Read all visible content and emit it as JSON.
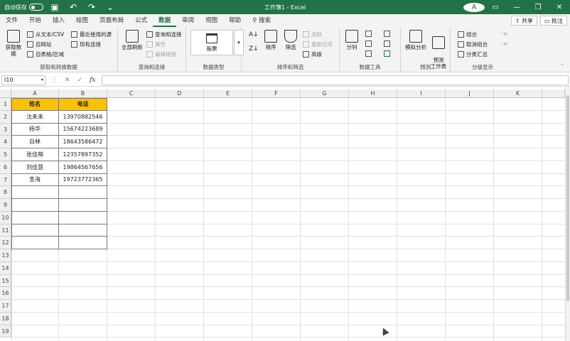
{
  "titlebar": {
    "autosave_label": "自动保存",
    "title": "工作簿1 - Excel",
    "avatar_letter": "A"
  },
  "menu": {
    "tabs": [
      "文件",
      "开始",
      "插入",
      "绘图",
      "页面布局",
      "公式",
      "数据",
      "审阅",
      "视图",
      "帮助",
      "搜索"
    ],
    "active": "数据",
    "share": "共享",
    "comments": "批注"
  },
  "ribbon": {
    "get_data": "获取数据",
    "from_text_csv": "从文本/CSV",
    "from_web": "自网站",
    "from_table": "自表格/区域",
    "recent_sources": "最近使用的源",
    "existing_conn": "现有连接",
    "group_get_transform": "获取和转换数据",
    "refresh_all": "全部刷新",
    "queries_conn": "查询和连接",
    "properties": "属性",
    "edit_links": "编辑链接",
    "group_queries": "查询和连接",
    "stocks": "股票",
    "group_data_types": "数据类型",
    "sort": "排序",
    "filter": "筛选",
    "clear": "清除",
    "reapply": "重新应用",
    "advanced": "高级",
    "group_sort_filter": "排序和筛选",
    "text_to_columns": "分列",
    "group_data_tools": "数据工具",
    "what_if": "模拟分析",
    "forecast_sheet": "预测\n工作表",
    "group_forecast": "预测",
    "group_btn": "组合",
    "ungroup": "取消组合",
    "subtotal": "分类汇总",
    "group_outline": "分级显示"
  },
  "formula_bar": {
    "name_box": "I10",
    "fx": "fx",
    "cancel": "✕",
    "enter": "✓",
    "value": ""
  },
  "columns": [
    "A",
    "B",
    "C",
    "D",
    "E",
    "F",
    "G",
    "H",
    "I",
    "J",
    "K"
  ],
  "rows": [
    "1",
    "2",
    "3",
    "4",
    "5",
    "6",
    "7",
    "8",
    "9",
    "10",
    "11",
    "12",
    "13",
    "14",
    "15",
    "16",
    "17",
    "18",
    "19"
  ],
  "table": {
    "headers": [
      "姓名",
      "电话"
    ],
    "rows": [
      [
        "沈未未",
        "13970882546"
      ],
      [
        "杨华",
        "15674223689"
      ],
      [
        "白林",
        "18643586472"
      ],
      [
        "张佳萌",
        "12357897352"
      ],
      [
        "刘佳慧",
        "19864567656"
      ],
      [
        "金海",
        "19723772365"
      ],
      [
        "",
        ""
      ],
      [
        "",
        ""
      ],
      [
        "",
        ""
      ],
      [
        "",
        ""
      ],
      [
        "",
        ""
      ]
    ]
  },
  "colors": {
    "excel_green": "#217346",
    "header_fill": "#ffc000"
  }
}
